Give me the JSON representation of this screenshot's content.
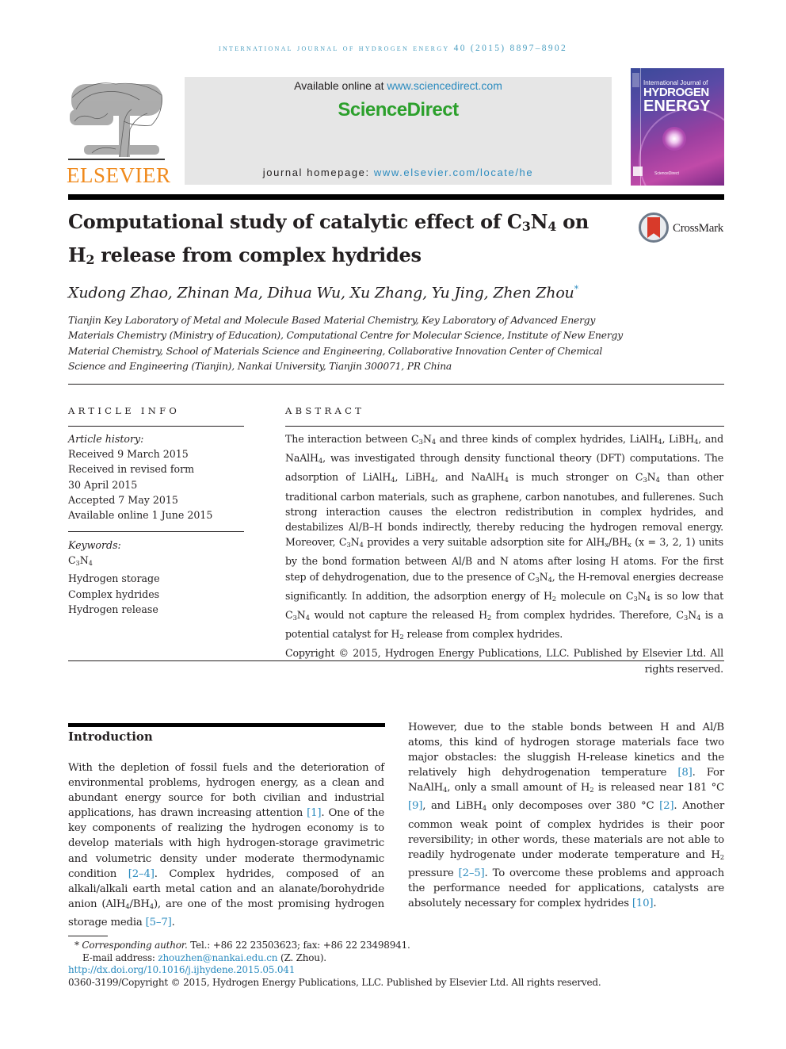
{
  "running_head": "International Journal of Hydrogen Energy 40 (2015) 8897–8902",
  "publisher": {
    "name": "ELSEVIER",
    "available_prefix": "Available online at ",
    "available_url": "www.sciencedirect.com",
    "platform": "ScienceDirect",
    "homepage_prefix": "journal homepage: ",
    "homepage_url": "www.elsevier.com/locate/he",
    "brand_color": "#f08a1c",
    "sd_color": "#2ca02c",
    "link_color": "#2b8bbf"
  },
  "cover": {
    "line1": "International Journal of",
    "line2": "HYDROGEN",
    "line3": "ENERGY",
    "footer": "ScienceDirect"
  },
  "crossmark_label": "CrossMark",
  "title": {
    "part1": "Computational study of catalytic effect of C",
    "sub1": "3",
    "part2": "N",
    "sub2": "4",
    "part3": " on",
    "part4": "H",
    "sub3": "2",
    "part5": " release from complex hydrides"
  },
  "authors": "Xudong Zhao, Zhinan Ma, Dihua Wu, Xu Zhang, Yu Jing, Zhen Zhou",
  "corresponding_mark": "*",
  "affiliation": "Tianjin Key Laboratory of Metal and Molecule Based Material Chemistry, Key Laboratory of Advanced Energy Materials Chemistry (Ministry of Education), Computational Centre for Molecular Science, Institute of New Energy Material Chemistry, School of Materials Science and Engineering, Collaborative Innovation Center of Chemical Science and Engineering (Tianjin), Nankai University, Tianjin 300071, PR China",
  "article_info": {
    "heading": "ARTICLE INFO",
    "history_label": "Article history:",
    "history": [
      "Received 9 March 2015",
      "Received in revised form",
      "30 April 2015",
      "Accepted 7 May 2015",
      "Available online 1 June 2015"
    ],
    "keywords_label": "Keywords:",
    "keywords": [
      "C3N4",
      "Hydrogen storage",
      "Complex hydrides",
      "Hydrogen release"
    ]
  },
  "abstract": {
    "heading": "ABSTRACT",
    "text": "The interaction between C3N4 and three kinds of complex hydrides, LiAlH4, LiBH4, and NaAlH4, was investigated through density functional theory (DFT) computations. The adsorption of LiAlH4, LiBH4, and NaAlH4 is much stronger on C3N4 than other traditional carbon materials, such as graphene, carbon nanotubes, and fullerenes. Such strong interaction causes the electron redistribution in complex hydrides, and destabilizes Al/B–H bonds indirectly, thereby reducing the hydrogen removal energy. Moreover, C3N4 provides a very suitable adsorption site for AlHx/BHx (x = 3, 2, 1) units by the bond formation between Al/B and N atoms after losing H atoms. For the first step of dehydrogenation, due to the presence of C3N4, the H-removal energies decrease significantly. In addition, the adsorption energy of H2 molecule on C3N4 is so low that C3N4 would not capture the released H2 from complex hydrides. Therefore, C3N4 is a potential catalyst for H2 release from complex hydrides.",
    "copyright": "Copyright © 2015, Hydrogen Energy Publications, LLC. Published by Elsevier Ltd. All rights reserved."
  },
  "introduction": {
    "heading": "Introduction",
    "col1": "With the depletion of fossil fuels and the deterioration of environmental problems, hydrogen energy, as a clean and abundant energy source for both civilian and industrial applications, has drawn increasing attention [1]. One of the key components of realizing the hydrogen economy is to develop materials with high hydrogen-storage gravimetric and volumetric density under moderate thermodynamic condition [2–4]. Complex hydrides, composed of an alkali/alkali earth metal cation and an alanate/borohydride anion (AlH4/BH4), are one of the most promising hydrogen storage media [5–7].",
    "col2": "However, due to the stable bonds between H and Al/B atoms, this kind of hydrogen storage materials face two major obstacles: the sluggish H-release kinetics and the relatively high dehydrogenation temperature [8]. For NaAlH4, only a small amount of H2 is released near 181 °C [9], and LiBH4 only decomposes over 380 °C [2]. Another common weak point of complex hydrides is their poor reversibility; in other words, these materials are not able to readily hydrogenate under moderate temperature and H2 pressure [2–5]. To overcome these problems and approach the performance needed for applications, catalysts are absolutely necessary for complex hydrides [10].",
    "refs": [
      "[1]",
      "[2–4]",
      "[5–7]",
      "[8]",
      "[9]",
      "[2]",
      "[2–5]",
      "[10]"
    ]
  },
  "footnotes": {
    "corr_label": "Corresponding author.",
    "tel": "Tel.: +86 22 23503623; fax: +86 22 23498941.",
    "email_label": "E-mail address: ",
    "email": "zhouzhen@nankai.edu.cn",
    "email_suffix": " (Z. Zhou).",
    "doi": "http://dx.doi.org/10.1016/j.ijhydene.2015.05.041",
    "issn_copyright": "0360-3199/Copyright © 2015, Hydrogen Energy Publications, LLC. Published by Elsevier Ltd. All rights reserved."
  }
}
